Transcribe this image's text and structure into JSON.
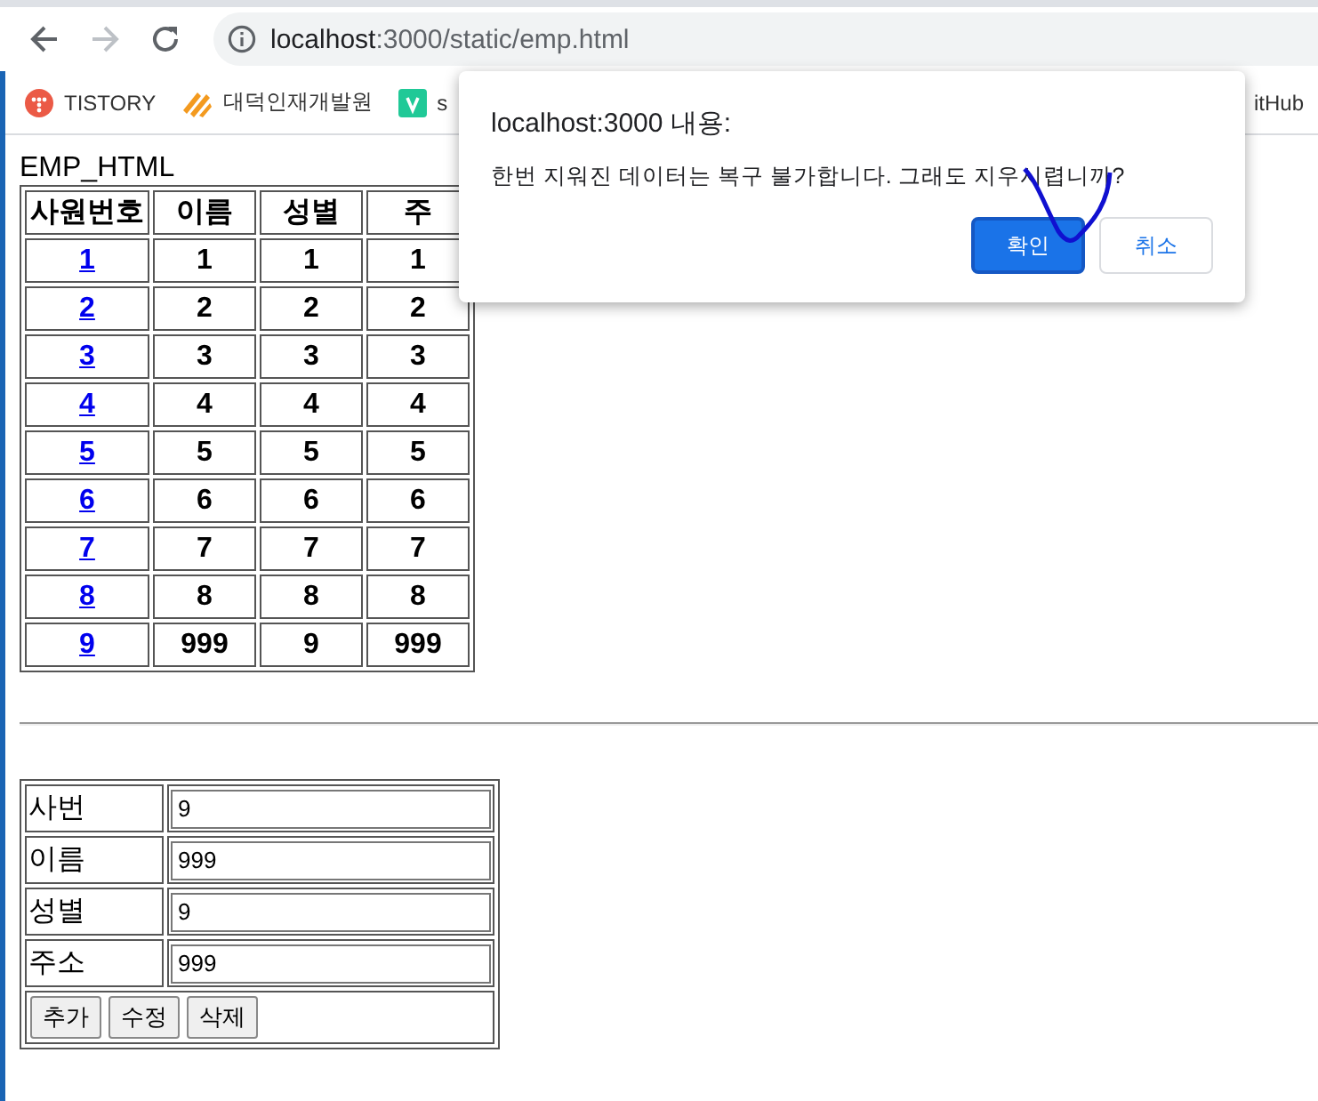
{
  "browser": {
    "nav": [
      {
        "kind": "back",
        "disabled": false
      },
      {
        "kind": "forward",
        "disabled": true
      },
      {
        "kind": "reload",
        "disabled": false
      }
    ],
    "url": {
      "host": "localhost",
      "path": ":3000/static/emp.html"
    },
    "bookmarks": [
      {
        "label": "TISTORY",
        "kind": "tistory"
      },
      {
        "label": "대덕인재개발원",
        "kind": "ddit"
      },
      {
        "label": "s",
        "kind": "v"
      },
      {
        "label": "itHub",
        "kind": "none"
      }
    ]
  },
  "page": {
    "caption": "EMP_HTML",
    "columns": [
      "사원번호",
      "이름",
      "성별",
      "주"
    ],
    "rows": [
      [
        "1",
        "1",
        "1",
        "1"
      ],
      [
        "2",
        "2",
        "2",
        "2"
      ],
      [
        "3",
        "3",
        "3",
        "3"
      ],
      [
        "4",
        "4",
        "4",
        "4"
      ],
      [
        "5",
        "5",
        "5",
        "5"
      ],
      [
        "6",
        "6",
        "6",
        "6"
      ],
      [
        "7",
        "7",
        "7",
        "7"
      ],
      [
        "8",
        "8",
        "8",
        "8"
      ],
      [
        "9",
        "999",
        "9",
        "999"
      ]
    ]
  },
  "form": {
    "fields": [
      {
        "label": "사번",
        "value": "9"
      },
      {
        "label": "이름",
        "value": "999"
      },
      {
        "label": "성별",
        "value": "9"
      },
      {
        "label": "주소",
        "value": "999"
      }
    ],
    "buttons": [
      "추가",
      "수정",
      "삭제"
    ]
  },
  "dialog": {
    "title": "localhost:3000 내용:",
    "message": "한번 지워진 데이터는 복구 불가합니다. 그래도 지우시렵니까?",
    "buttons": [
      {
        "label": "확인",
        "kind": "primary"
      },
      {
        "label": "취소",
        "kind": "secondary"
      }
    ]
  }
}
